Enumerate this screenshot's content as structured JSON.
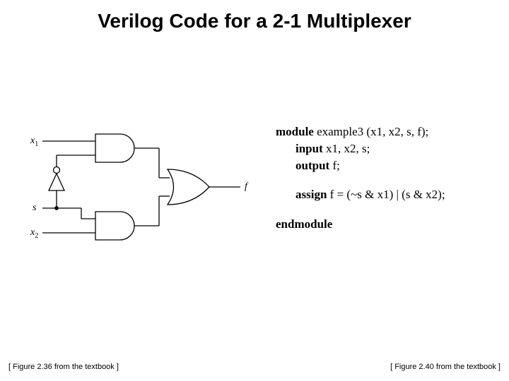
{
  "title": "Verilog Code for a 2-1 Multiplexer",
  "schematic": {
    "labels": {
      "x1": "x",
      "x1_sub": "1",
      "s": "s",
      "x2": "x",
      "x2_sub": "2",
      "f": "f"
    }
  },
  "code": {
    "module_kw": "module",
    "module_decl": " example3 (x1, x2, s, f);",
    "input_kw": "input",
    "input_decl": " x1, x2, s;",
    "output_kw": "output",
    "output_decl": " f;",
    "assign_kw": "assign",
    "assign_expr": " f = (~s & x1) | (s & x2);",
    "endmodule_kw": "endmodule"
  },
  "captions": {
    "left": "[ Figure 2.36 from the textbook ]",
    "right": "[ Figure 2.40 from the textbook ]"
  }
}
